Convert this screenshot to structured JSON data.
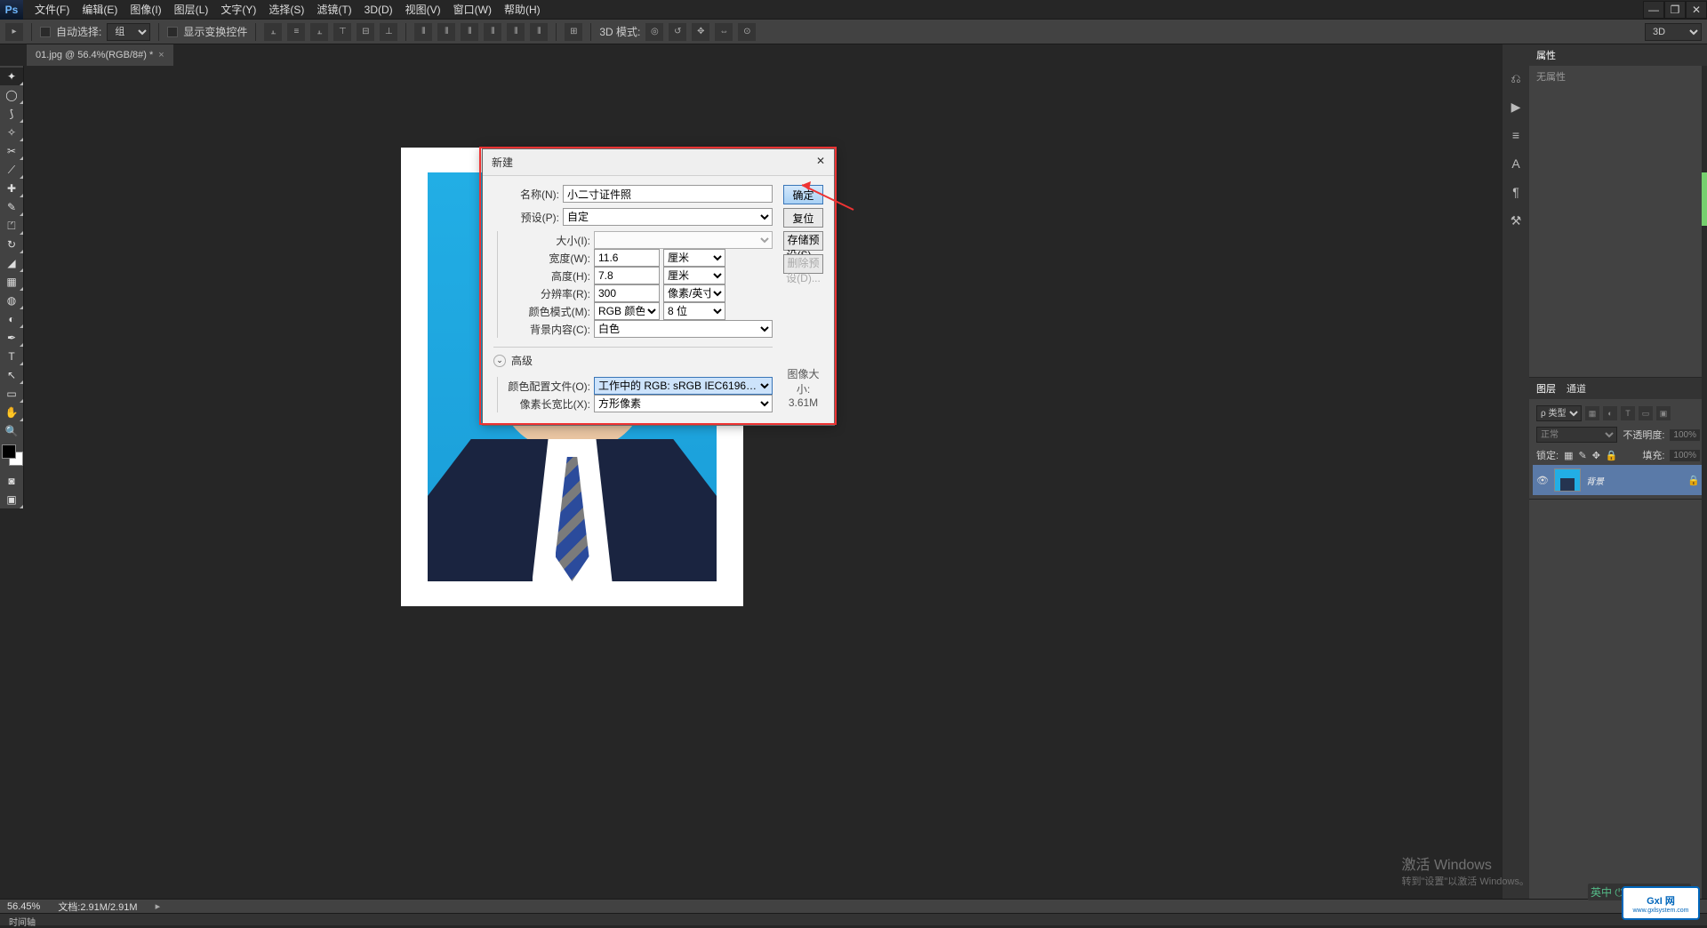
{
  "menubar": {
    "items": [
      "文件(F)",
      "编辑(E)",
      "图像(I)",
      "图层(L)",
      "文字(Y)",
      "选择(S)",
      "滤镜(T)",
      "3D(D)",
      "视图(V)",
      "窗口(W)",
      "帮助(H)"
    ]
  },
  "options": {
    "auto_select_label": "自动选择:",
    "auto_select_value": "组",
    "transform_controls": "显示变换控件",
    "mode_3d_label": "3D 模式:",
    "mode_3d_value": "3D"
  },
  "doc_tab": {
    "title": "01.jpg @ 56.4%(RGB/8#) *"
  },
  "dialog": {
    "title": "新建",
    "name_label": "名称(N):",
    "name_value": "小二寸证件照",
    "preset_label": "预设(P):",
    "preset_value": "自定",
    "size_label": "大小(I):",
    "width_label": "宽度(W):",
    "width_value": "11.6",
    "width_unit": "厘米",
    "height_label": "高度(H):",
    "height_value": "7.8",
    "height_unit": "厘米",
    "resolution_label": "分辨率(R):",
    "resolution_value": "300",
    "resolution_unit": "像素/英寸",
    "color_mode_label": "颜色模式(M):",
    "color_mode_value": "RGB 颜色",
    "color_depth_value": "8 位",
    "bg_label": "背景内容(C):",
    "bg_value": "白色",
    "advanced_label": "高级",
    "profile_label": "颜色配置文件(O):",
    "profile_value": "工作中的 RGB: sRGB IEC6196…",
    "aspect_label": "像素长宽比(X):",
    "aspect_value": "方形像素",
    "ok": "确定",
    "reset": "复位",
    "save_preset": "存储预设(S)...",
    "delete_preset": "删除预设(D)...",
    "image_size_label": "图像大小:",
    "image_size_value": "3.61M"
  },
  "properties": {
    "tab": "属性",
    "body": "无属性"
  },
  "layers": {
    "tabs": [
      "图层",
      "通道"
    ],
    "kind_label": "ρ 类型",
    "blend_mode": "正常",
    "opacity_label": "不透明度:",
    "opacity_value": "100%",
    "lock_label": "锁定:",
    "fill_label": "填充:",
    "fill_value": "100%",
    "layer_name": "背景"
  },
  "status": {
    "zoom": "56.45%",
    "doc": "文档:2.91M/2.91M"
  },
  "timeline": {
    "label": "时间轴"
  },
  "activation": {
    "line1": "激活 Windows",
    "line2": "转到\"设置\"以激活 Windows。"
  },
  "gxl": {
    "brand": "GxI 网",
    "url": "www.gxlsystem.com"
  },
  "tray": {
    "text": "英中 ⏻ • ა ≡ ♪  📶 📧"
  }
}
